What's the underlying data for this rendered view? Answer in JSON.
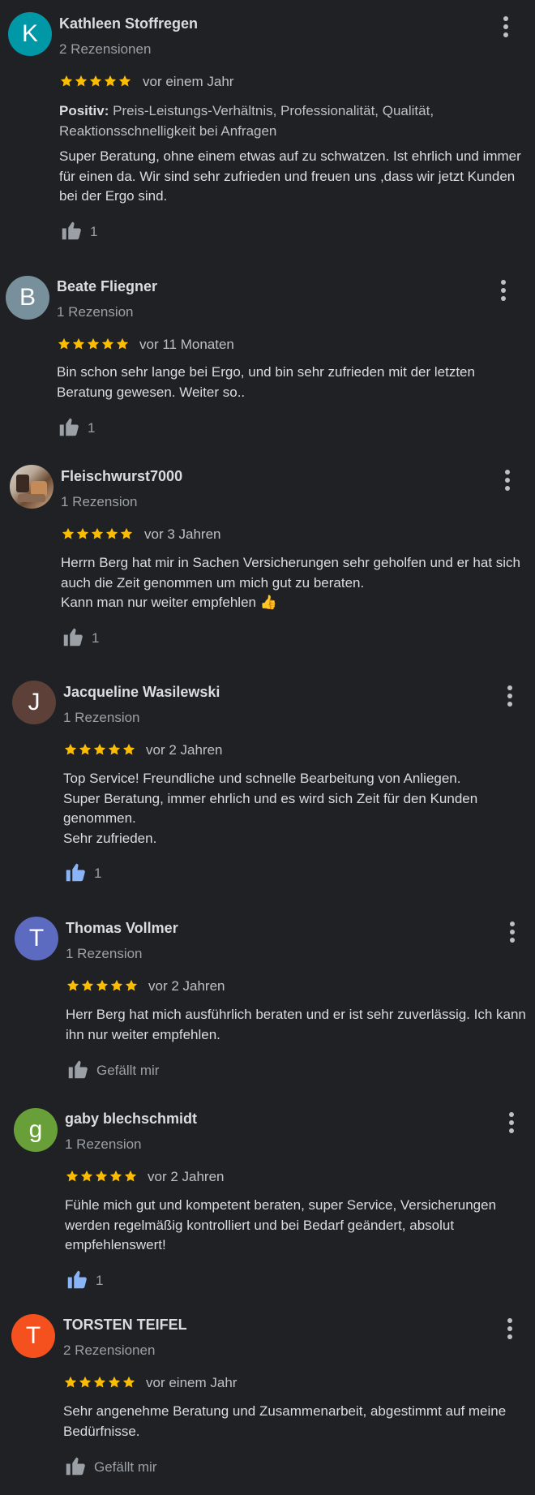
{
  "colors": {
    "background": "#202124",
    "star": "#fbbc04",
    "thumb_default": "#9aa0a6",
    "thumb_active": "#8ab4f8"
  },
  "reviews": [
    {
      "avatar_letter": "K",
      "avatar_color": "#0097a7",
      "name": "Kathleen Stoffregen",
      "count_label": "2 Rezensionen",
      "rating": 5,
      "date": "vor einem Jahr",
      "positive_label": "Positiv:",
      "positive_text": " Preis-Leistungs-Verhältnis, Professionalität, Qualität,\n Reaktionsschnelligkeit bei Anfragen",
      "text": "Super Beratung, ohne einem etwas auf zu schwatzen. Ist ehrlich und immer\nfür einen da. Wir sind sehr zufrieden und freuen uns ,dass wir jetzt Kunden\nbei der Ergo sind.",
      "like_label": "1",
      "like_active": false
    },
    {
      "avatar_letter": "B",
      "avatar_color": "#78909c",
      "name": "Beate Fliegner",
      "count_label": "1 Rezension",
      "rating": 5,
      "date": "vor 11 Monaten",
      "text": "Bin schon sehr lange bei Ergo, und bin sehr zufrieden mit der letzten\nBeratung gewesen. Weiter so..",
      "like_label": "1",
      "like_active": false
    },
    {
      "avatar_letter": "",
      "avatar_color": "#8a6a52",
      "avatar_icon": "profile-photo",
      "name": "Fleischwurst7000",
      "count_label": "1 Rezension",
      "rating": 5,
      "date": "vor 3 Jahren",
      "text": "Herrn Berg hat mir in Sachen Versicherungen sehr geholfen und er hat sich\nauch die Zeit genommen um mich gut zu beraten.\nKann man nur weiter empfehlen 👍",
      "like_label": "1",
      "like_active": false
    },
    {
      "avatar_letter": "J",
      "avatar_color": "#5d4037",
      "name": "Jacqueline Wasilewski",
      "count_label": "1 Rezension",
      "rating": 5,
      "date": "vor 2 Jahren",
      "text": "Top Service! Freundliche und schnelle Bearbeitung von Anliegen.\nSuper Beratung, immer ehrlich und es wird sich Zeit für den Kunden\ngenommen.\nSehr zufrieden.",
      "like_label": "1",
      "like_active": true
    },
    {
      "avatar_letter": "T",
      "avatar_color": "#5c6bc0",
      "name": "Thomas Vollmer",
      "count_label": "1 Rezension",
      "rating": 5,
      "date": "vor 2 Jahren",
      "text": "Herr Berg hat mich ausführlich beraten und er ist sehr zuverlässig. Ich kann\nihn nur weiter empfehlen.",
      "like_label": "Gefällt mir",
      "like_active": false
    },
    {
      "avatar_letter": "g",
      "avatar_color": "#689f38",
      "name": "gaby blechschmidt",
      "count_label": "1 Rezension",
      "rating": 5,
      "date": "vor 2 Jahren",
      "text": "Fühle mich gut und kompetent beraten, super Service, Versicherungen\nwerden regelmäßig kontrolliert und bei Bedarf geändert, absolut\nempfehlenswert!",
      "like_label": "1",
      "like_active": true
    },
    {
      "avatar_letter": "T",
      "avatar_color": "#f4511e",
      "name": "TORSTEN TEIFEL",
      "count_label": "2 Rezensionen",
      "rating": 5,
      "date": "vor einem Jahr",
      "text": "Sehr angenehme Beratung und Zusammenarbeit, abgestimmt auf meine\nBedürfnisse.",
      "like_label": "Gefällt mir",
      "like_active": false
    }
  ]
}
